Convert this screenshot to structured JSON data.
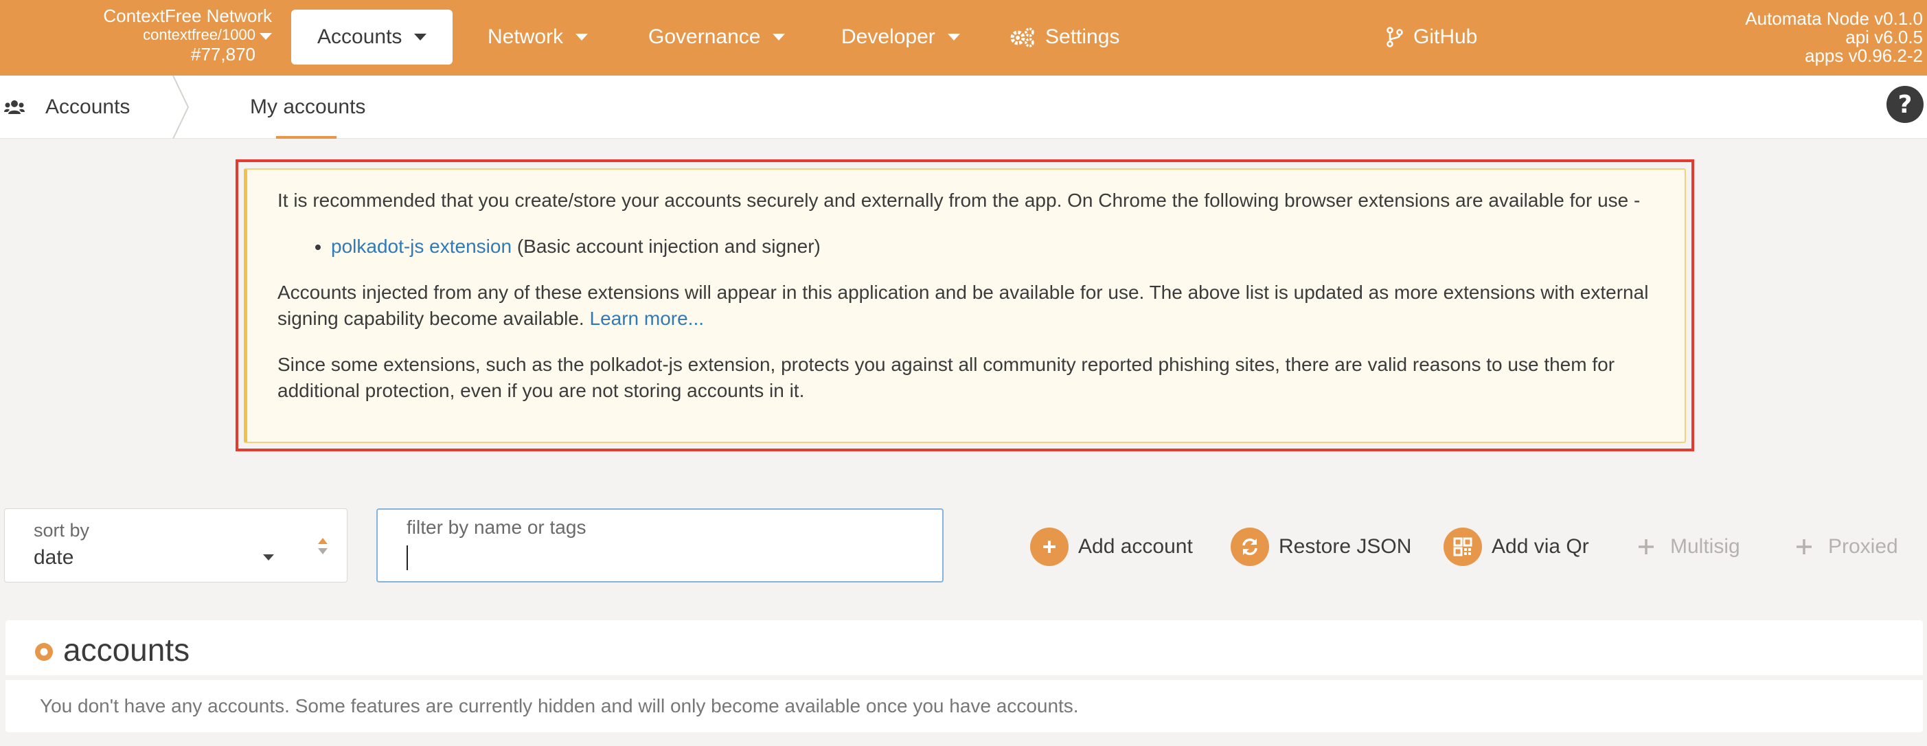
{
  "topbar": {
    "chain_name": "ContextFree Network",
    "chain_sub": "contextfree/1000",
    "block": "#77,870",
    "nav": [
      {
        "label": "Accounts",
        "active": true
      },
      {
        "label": "Network"
      },
      {
        "label": "Governance"
      },
      {
        "label": "Developer"
      },
      {
        "label": "Settings"
      }
    ],
    "github_label": "GitHub",
    "node": [
      "Automata Node v0.1.0",
      "api v6.0.5",
      "apps v0.96.2-2"
    ]
  },
  "subbar": {
    "crumb": "Accounts",
    "tab": "My accounts"
  },
  "info": {
    "p1": "It is recommended that you create/store your accounts securely and externally from the app. On Chrome the following browser extensions are available for use -",
    "ext_link": "polkadot-js extension",
    "ext_desc": " (Basic account injection and signer)",
    "p2": "Accounts injected from any of these extensions will appear in this application and be available for use. The above list is updated as more extensions with external signing capability become available. ",
    "learn_more": "Learn more...",
    "p3": "Since some extensions, such as the polkadot-js extension, protects you against all community reported phishing sites, there are valid reasons to use them for additional protection, even if you are not storing accounts in it."
  },
  "controls": {
    "sort_label": "sort by",
    "sort_value": "date",
    "filter_label": "filter by name or tags",
    "filter_value": "",
    "actions": {
      "add": "Add account",
      "restore": "Restore JSON",
      "qr": "Add via Qr",
      "multisig": "Multisig",
      "proxied": "Proxied"
    }
  },
  "accounts": {
    "title": "accounts",
    "empty": "You don't have any accounts. Some features are currently hidden and will only become available once you have accounts."
  },
  "colors": {
    "accent": "#e6974a",
    "link": "#2f7ab7",
    "highlight": "#e53a2f",
    "warning_bg": "#fefaee"
  }
}
